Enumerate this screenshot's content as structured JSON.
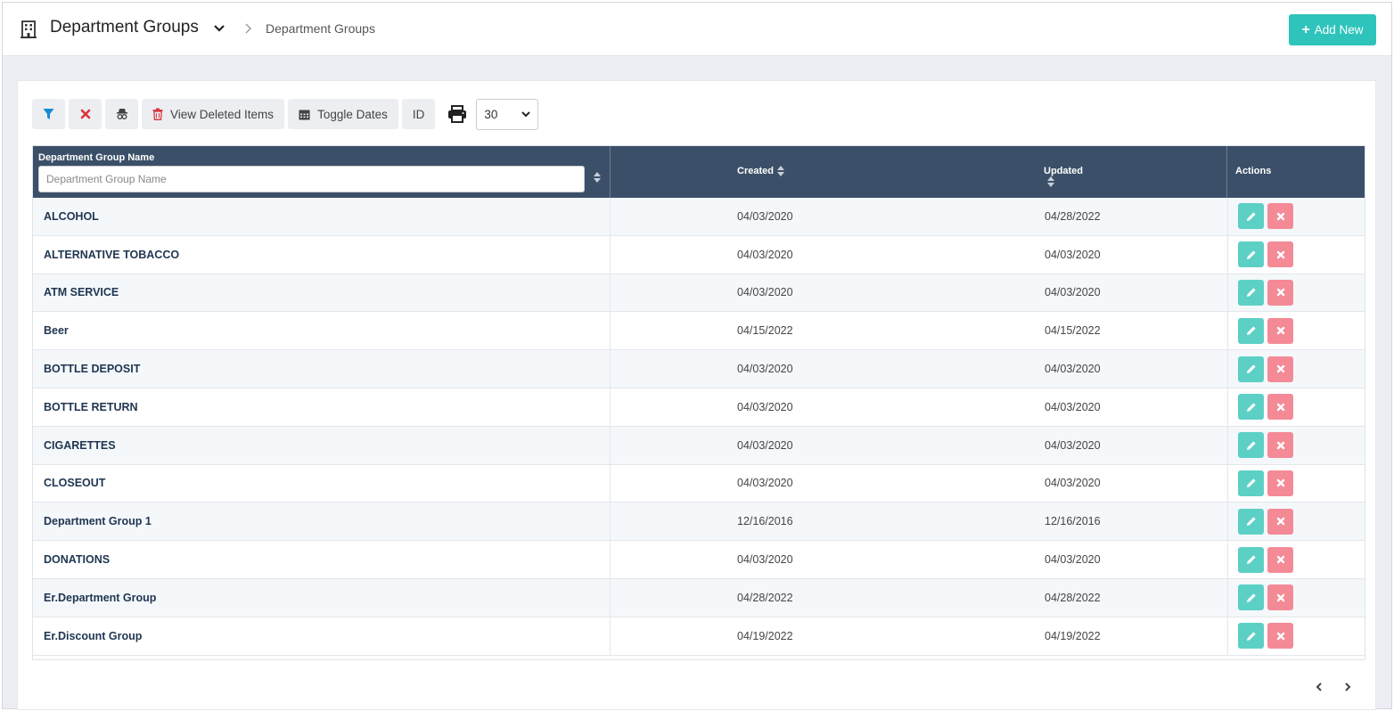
{
  "header": {
    "title": "Department Groups",
    "breadcrumb_current": "Department Groups",
    "add_button_label": "Add New"
  },
  "toolbar": {
    "view_deleted_label": "View Deleted Items",
    "toggle_dates_label": "Toggle Dates",
    "id_label": "ID",
    "page_size": "30"
  },
  "table": {
    "columns": {
      "name": "Department Group Name",
      "created": "Created",
      "updated": "Updated",
      "actions": "Actions"
    },
    "name_filter_placeholder": "Department Group Name",
    "rows": [
      {
        "name": "ALCOHOL",
        "created": "04/03/2020",
        "updated": "04/28/2022"
      },
      {
        "name": "ALTERNATIVE TOBACCO",
        "created": "04/03/2020",
        "updated": "04/03/2020"
      },
      {
        "name": "ATM SERVICE",
        "created": "04/03/2020",
        "updated": "04/03/2020"
      },
      {
        "name": "Beer",
        "created": "04/15/2022",
        "updated": "04/15/2022"
      },
      {
        "name": "BOTTLE DEPOSIT",
        "created": "04/03/2020",
        "updated": "04/03/2020"
      },
      {
        "name": "BOTTLE RETURN",
        "created": "04/03/2020",
        "updated": "04/03/2020"
      },
      {
        "name": "CIGARETTES",
        "created": "04/03/2020",
        "updated": "04/03/2020"
      },
      {
        "name": "CLOSEOUT",
        "created": "04/03/2020",
        "updated": "04/03/2020"
      },
      {
        "name": "Department Group 1",
        "created": "12/16/2016",
        "updated": "12/16/2016"
      },
      {
        "name": "DONATIONS",
        "created": "04/03/2020",
        "updated": "04/03/2020"
      },
      {
        "name": "Er.Department Group",
        "created": "04/28/2022",
        "updated": "04/28/2022"
      },
      {
        "name": "Er.Discount Group",
        "created": "04/19/2022",
        "updated": "04/19/2022"
      }
    ]
  },
  "colors": {
    "accent": "#2ec4bb",
    "table_header": "#3b5068",
    "edit": "#5dd0c6",
    "delete": "#f58a97",
    "filter_icon": "#1a8ad4",
    "clear_icon": "#d9363e"
  },
  "icons": {
    "title": "building-icon",
    "filter": "filter-icon",
    "clear": "close-icon",
    "spy": "incognito-icon",
    "deleted": "trash-icon",
    "dates": "calendar-icon",
    "print": "print-icon",
    "edit": "pencil-icon",
    "delete": "close-icon",
    "prev": "chevron-left-icon",
    "next": "chevron-right-icon"
  }
}
